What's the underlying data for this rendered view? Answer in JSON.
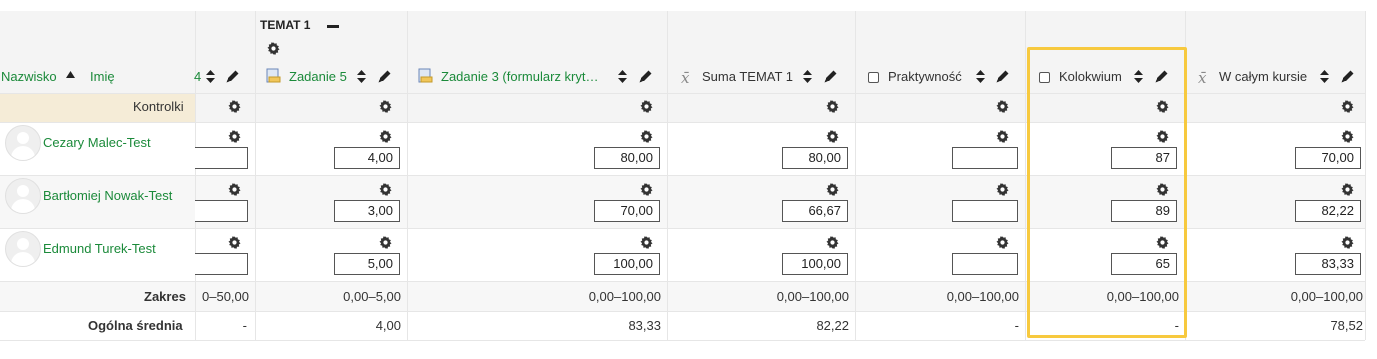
{
  "section": {
    "title": "TEMAT 1",
    "collapse_symbol": "—"
  },
  "sort_headers": {
    "surname": "Nazwisko",
    "firstname": "Imię"
  },
  "columns": [
    {
      "key": "prev",
      "label": "4",
      "icon": "partial-sort-arrows"
    },
    {
      "key": "zad5",
      "label": "Zadanie 5",
      "icon": "assignment-icon"
    },
    {
      "key": "zad3",
      "label": "Zadanie 3 (formularz kryt…",
      "icon": "assignment-icon"
    },
    {
      "key": "suma",
      "label": "Suma TEMAT 1",
      "icon": "sigma-icon"
    },
    {
      "key": "prakt",
      "label": "Praktywność",
      "icon": "checkbox-icon"
    },
    {
      "key": "kolok",
      "label": "Kolokwium",
      "icon": "checkbox-icon",
      "highlighted": true
    },
    {
      "key": "kurs",
      "label": "W całym kursie",
      "icon": "sigma-icon"
    }
  ],
  "controls_label": "Kontrolki",
  "students": [
    {
      "name": "Cezary Malec-Test",
      "grades": {
        "prev": "",
        "zad5": "4,00",
        "zad3": "80,00",
        "suma": "80,00",
        "prakt": "",
        "kolok": "87",
        "kurs": "70,00"
      }
    },
    {
      "name": "Bartłomiej Nowak-Test",
      "grades": {
        "prev": "",
        "zad5": "3,00",
        "zad3": "70,00",
        "suma": "66,67",
        "prakt": "",
        "kolok": "89",
        "kurs": "82,22"
      }
    },
    {
      "name": "Edmund Turek-Test",
      "grades": {
        "prev": "",
        "zad5": "5,00",
        "zad3": "100,00",
        "suma": "100,00",
        "prakt": "",
        "kolok": "65",
        "kurs": "83,33"
      }
    }
  ],
  "range": {
    "label": "Zakres",
    "values": {
      "prev": "0–50,00",
      "zad5": "0,00–5,00",
      "zad3": "0,00–100,00",
      "suma": "0,00–100,00",
      "prakt": "0,00–100,00",
      "kolok": "0,00–100,00",
      "kurs": "0,00–100,00"
    }
  },
  "average": {
    "label": "Ogólna średnia",
    "values": {
      "prev": "-",
      "zad5": "4,00",
      "zad3": "83,33",
      "suma": "82,22",
      "prakt": "-",
      "kolok": "-",
      "kurs": "78,52"
    }
  },
  "colors": {
    "link_green": "#1b8a3a",
    "highlight": "#f7c93e",
    "controls_bg": "#f5ecd7",
    "band": "#f7f7f7"
  }
}
